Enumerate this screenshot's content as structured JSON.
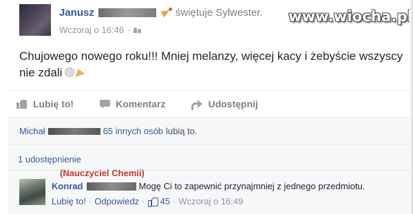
{
  "post": {
    "author": "Janusz",
    "activity": "świętuje Sylwester.",
    "time": "Wczoraj o 16:46",
    "audience_icon": "friends-icon",
    "text": "Chujowego nowego roku!!! Mniej melanzy, więcej kacy i żebyście wszyscy nie zdali"
  },
  "watermark": "www.wiocha.pl",
  "actions": {
    "like": "Lubię to!",
    "comment": "Komentarz",
    "share": "Udostępnij"
  },
  "likes": {
    "name": "Michał",
    "others": "65 innych osób",
    "suffix": "lubią to."
  },
  "shares": "1 udostępnienie",
  "annotation": "(Nauczyciel Chemii)",
  "comment": {
    "author": "Konrad",
    "text": "Mogę Ci to zapewnić przynajmniej z jednego przedmiotu.",
    "like": "Lubię to!",
    "reply": "Odpowiedz",
    "like_count": "45",
    "time": "Wczoraj o 16:49"
  },
  "colors": {
    "link": "#365899",
    "annotation": "#c0392b"
  }
}
